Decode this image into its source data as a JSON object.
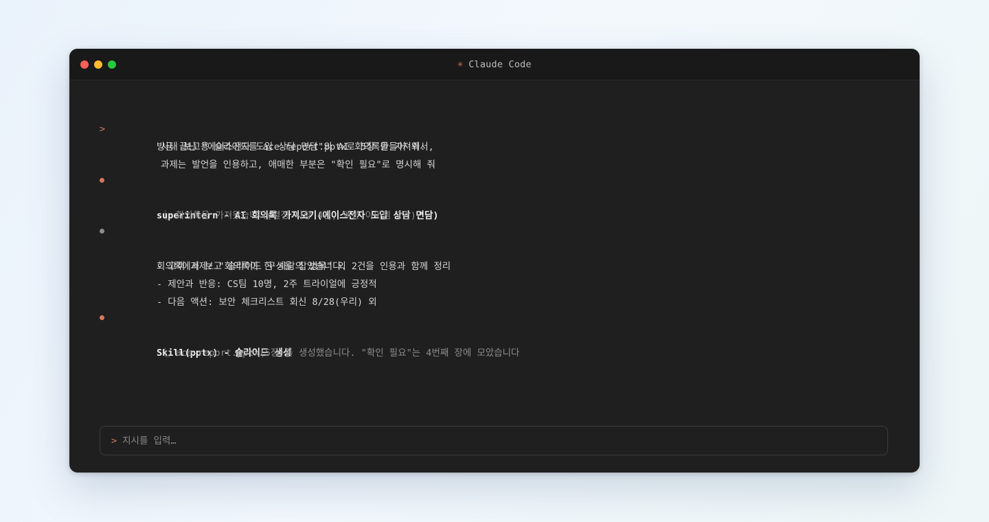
{
  "window": {
    "title": "Claude Code",
    "title_icon": "asterisk-icon"
  },
  "conversation": {
    "user_prompt": {
      "marker": ">",
      "lines": [
        "방금 끝난 \"에이스전자 도입 상담 면담\"의 AI 회의록을 가져와서,",
        "사내 보고용 슬라이드를 ace-report.pptx로 5장 만들어 줘.",
        "과제는 발언을 인용하고, 애매한 부분은 \"확인 필요\"로 명시해 줘"
      ]
    },
    "tool_call_1": {
      "title": "superintern - AI 회의록 가져오기(에이스전자 도입 상담 면담)",
      "result": "⎿ 회의록을 가져왔습니다(결정 사항 4건, 액션 아이템 2건)"
    },
    "assistant_message": {
      "text": "회의록에서 보고 슬라이드 구성을 잡았습니다.",
      "items": [
        "- 고객 과제: \"회의록이 한 사람의 병목\" 외 2건을 인용과 함께 정리",
        "- 제안과 반응: CS팀 10명, 2주 트라이얼에 긍정적",
        "- 다음 액션: 보안 체크리스트 회신 8/28(우리) 외"
      ]
    },
    "tool_call_2": {
      "title": "Skill(pptx) - 슬라이드 생성",
      "result": "⎿ ace-report.pptx(5장)를 생성했습니다. \"확인 필요\"는 4번째 장에 모았습니다"
    }
  },
  "input": {
    "marker": ">",
    "placeholder": "지시를 입력…",
    "value": ""
  },
  "colors": {
    "accent": "#d97757",
    "window_bg": "#1f1f1f",
    "titlebar_bg": "#191919",
    "text": "#d6d6d6",
    "muted_text": "#8c8c8c"
  }
}
